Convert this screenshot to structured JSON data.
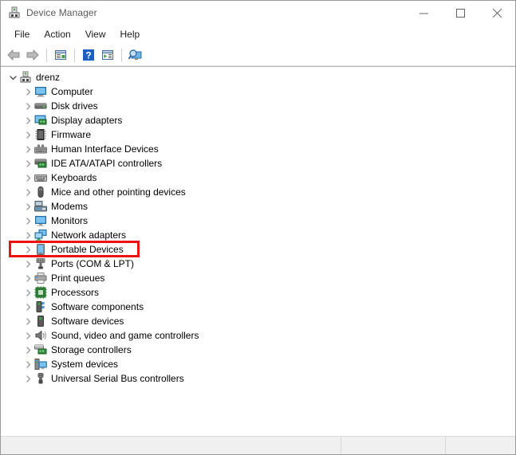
{
  "window": {
    "title": "Device Manager",
    "icon": "device-manager-icon",
    "controls": [
      {
        "name": "minimize-button",
        "glyph": "minimize"
      },
      {
        "name": "maximize-button",
        "glyph": "maximize"
      },
      {
        "name": "close-button",
        "glyph": "close"
      }
    ]
  },
  "menubar": {
    "items": [
      {
        "label": "File",
        "name": "menu-file"
      },
      {
        "label": "Action",
        "name": "menu-action"
      },
      {
        "label": "View",
        "name": "menu-view"
      },
      {
        "label": "Help",
        "name": "menu-help"
      }
    ]
  },
  "toolbar": {
    "buttons": [
      {
        "name": "back-button",
        "icon": "back-arrow-icon"
      },
      {
        "name": "forward-button",
        "icon": "forward-arrow-icon"
      },
      {
        "name": "separator-1",
        "icon": "separator"
      },
      {
        "name": "properties-button",
        "icon": "properties-icon"
      },
      {
        "name": "separator-2",
        "icon": "separator"
      },
      {
        "name": "help-button",
        "icon": "help-question-icon"
      },
      {
        "name": "update-driver-button",
        "icon": "update-driver-icon"
      },
      {
        "name": "separator-3",
        "icon": "separator"
      },
      {
        "name": "scan-hardware-changes-button",
        "icon": "scan-monitor-magnifier-icon"
      }
    ]
  },
  "tree": {
    "root": {
      "label": "drenz",
      "expanded": true,
      "icon": "computer-node-icon"
    },
    "nodes": [
      {
        "label": "Computer",
        "icon": "computer-icon"
      },
      {
        "label": "Disk drives",
        "icon": "disk-drive-icon"
      },
      {
        "label": "Display adapters",
        "icon": "display-adapter-icon"
      },
      {
        "label": "Firmware",
        "icon": "firmware-chip-icon"
      },
      {
        "label": "Human Interface Devices",
        "icon": "hid-icon"
      },
      {
        "label": "IDE ATA/ATAPI controllers",
        "icon": "ide-controller-icon"
      },
      {
        "label": "Keyboards",
        "icon": "keyboard-icon"
      },
      {
        "label": "Mice and other pointing devices",
        "icon": "mouse-icon"
      },
      {
        "label": "Modems",
        "icon": "modem-icon"
      },
      {
        "label": "Monitors",
        "icon": "monitor-icon"
      },
      {
        "label": "Network adapters",
        "icon": "network-adapter-icon"
      },
      {
        "label": "Portable Devices",
        "icon": "portable-device-icon",
        "highlighted": true
      },
      {
        "label": "Ports (COM & LPT)",
        "icon": "port-connector-icon"
      },
      {
        "label": "Print queues",
        "icon": "printer-icon"
      },
      {
        "label": "Processors",
        "icon": "processor-icon"
      },
      {
        "label": "Software components",
        "icon": "software-component-icon"
      },
      {
        "label": "Software devices",
        "icon": "software-device-icon"
      },
      {
        "label": "Sound, video and game controllers",
        "icon": "speaker-icon"
      },
      {
        "label": "Storage controllers",
        "icon": "storage-controller-icon"
      },
      {
        "label": "System devices",
        "icon": "system-device-icon"
      },
      {
        "label": "Universal Serial Bus controllers",
        "icon": "usb-icon"
      }
    ]
  },
  "statusbar": {
    "panes": [
      "",
      "",
      ""
    ]
  },
  "colors": {
    "highlight_box": "#ee1111",
    "window_border": "#9a9a9a",
    "title_text": "#5a5a5a",
    "statusbar_bg": "#f0f0f0"
  }
}
